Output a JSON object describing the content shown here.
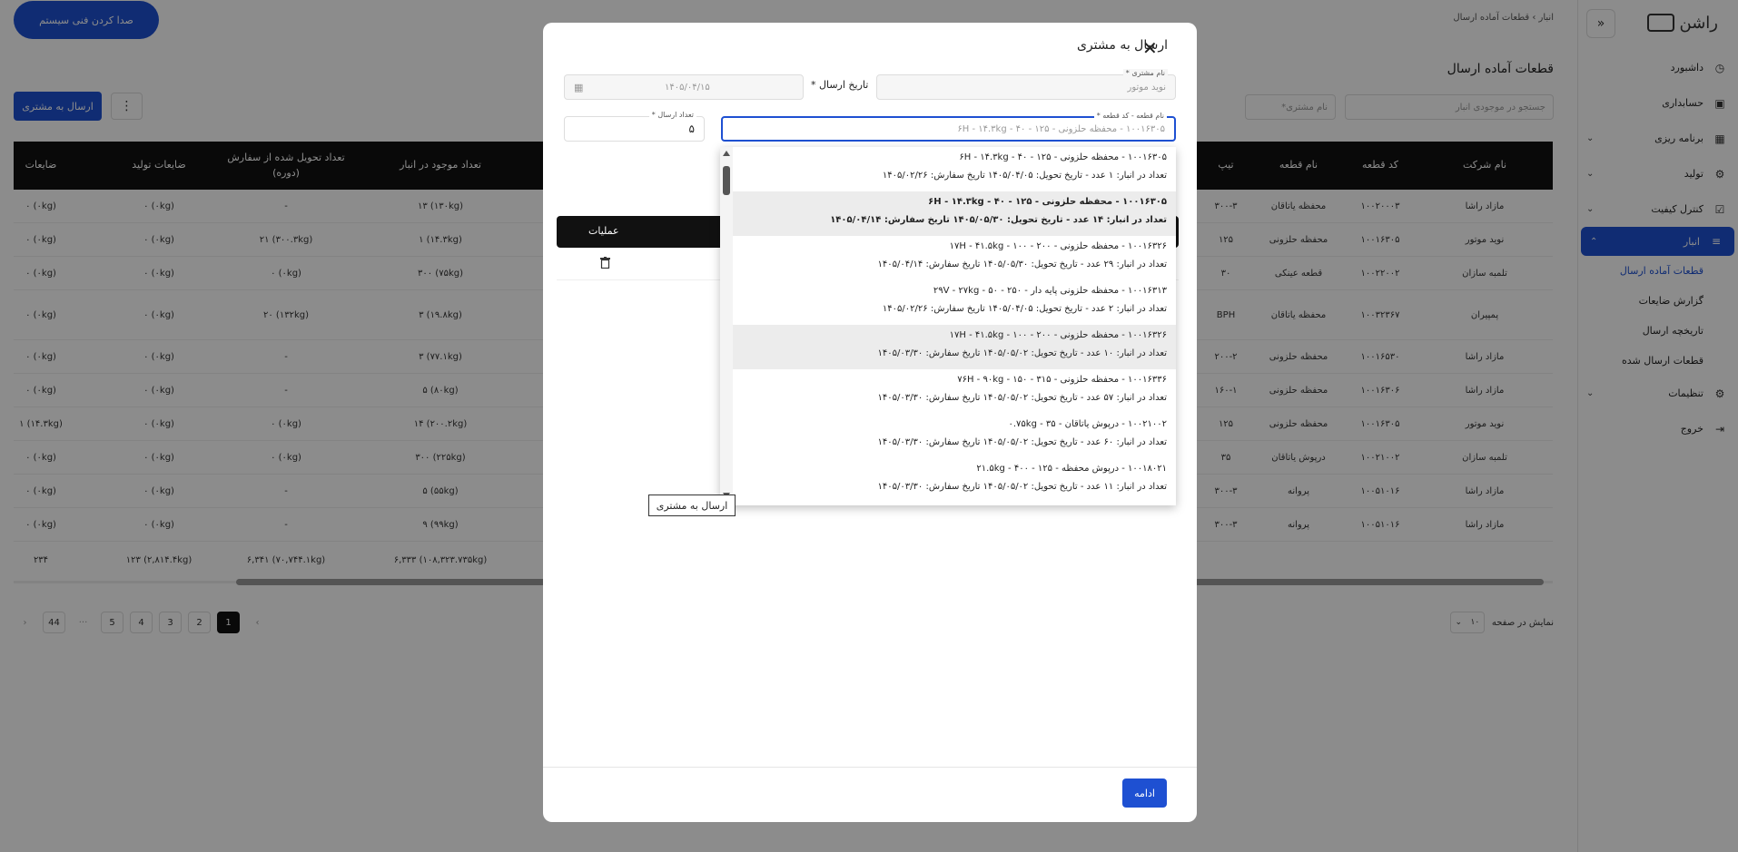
{
  "sidebar": {
    "logo_text": "راشن",
    "items": [
      {
        "label": "داشبورد",
        "icon": "dashboard-icon",
        "chev": ""
      },
      {
        "label": "حسابداری",
        "icon": "calculator-icon",
        "chev": ""
      },
      {
        "label": "برنامه ریزی",
        "icon": "calendar-icon",
        "chev": "⌄"
      },
      {
        "label": "تولید",
        "icon": "factory-icon",
        "chev": "⌄"
      },
      {
        "label": "کنترل کیفیت",
        "icon": "checkbox-icon",
        "chev": "⌄"
      }
    ],
    "active_item": {
      "label": "انبار",
      "icon": "database-icon",
      "chev": "⌃"
    },
    "sub_items": [
      "قطعات آماده ارسال",
      "گزارش ضایعات",
      "تاریخچه ارسال",
      "قطعات ارسال شده"
    ],
    "bottom_items": [
      {
        "label": "تنظیمات",
        "icon": "gear-icon",
        "chev": "⌄"
      },
      {
        "label": "خروج",
        "icon": "logout-icon",
        "chev": ""
      }
    ]
  },
  "breadcrumb": "انبار › قطعات آماده ارسال",
  "page_title": "قطعات آماده ارسال",
  "filters": {
    "search_placeholder": "جستجو در موجودی انبار",
    "customer_placeholder": "نام مشتری*"
  },
  "toolbar": {
    "send_label": "ارسال به مشتری",
    "more_label": "⋮"
  },
  "support_button": "صدا کردن فنی سیستم",
  "table": {
    "headers": [
      "نام شرکت",
      "کد قطعه",
      "نام قطعه",
      "تیپ",
      "تعداد موجود در انبار",
      "تعداد تحویل شده از سفارش (دوره)",
      "ضایعات تولید",
      "ضایعات"
    ],
    "rows": [
      [
        "مازاد راشا",
        "۱۰۰۲۰۰۰۳",
        "محفظه یاتاقان",
        "۳۰۰-۳",
        "(۱۳۰kg) ۱۳",
        "-",
        "(۰kg) ۰",
        "(۰kg) ۰"
      ],
      [
        "نوید موتور",
        "۱۰۰۱۶۳۰۵",
        "محفظه حلزونی",
        "۱۲۵",
        "(۱۴.۳kg) ۱",
        "(۳۰۰.۳kg) ۲۱",
        "(۰kg) ۰",
        "(۰kg) ۰"
      ],
      [
        "تلمبه سازان",
        "۱۰۰۲۲۰۰۲",
        "قطعه عینکی",
        "۳۰",
        "(۷۵kg) ۳۰۰",
        "(۰kg) ۰",
        "(۰kg) ۰",
        "(۰kg) ۰"
      ],
      [
        "پمپیران",
        "۱۰۰۳۲۳۶۷",
        "محفظه یاتاقان",
        "BPH",
        "(۱۹.۸kg) ۳",
        "(۱۳۲kg) ۲۰",
        "(۰kg) ۰",
        "(۰kg) ۰"
      ],
      [
        "مازاد راشا",
        "۱۰۰۱۶۵۳۰",
        "محفظه حلزونی",
        "۲۰۰-۲",
        "(۷۷.۱kg) ۳",
        "-",
        "(۰kg) ۰",
        "(۰kg) ۰"
      ],
      [
        "مازاد راشا",
        "۱۰۰۱۶۳۰۶",
        "محفظه حلزونی",
        "۱۶۰-۱",
        "(۸۰kg) ۵",
        "-",
        "(۰kg) ۰",
        "(۰kg) ۰"
      ],
      [
        "نوید موتور",
        "۱۰۰۱۶۳۰۵",
        "محفظه حلزونی",
        "۱۲۵",
        "(۲۰۰.۲kg) ۱۴",
        "(۰kg) ۰",
        "(۰kg) ۰",
        "(۱۴.۳kg) ۱"
      ],
      [
        "تلمبه سازان",
        "۱۰۰۲۱۰۰۲",
        "درپوش یاتاقان",
        "۳۵",
        "(۲۲۵kg) ۳۰۰",
        "(۰kg) ۰",
        "(۰kg) ۰",
        "(۰kg) ۰"
      ],
      [
        "مازاد راشا",
        "۱۰۰۵۱۰۱۶",
        "پروانه",
        "۳۰۰-۳",
        "(۵۵kg) ۵",
        "-",
        "(۰kg) ۰",
        "(۰kg) ۰"
      ],
      [
        "مازاد راشا",
        "۱۰۰۵۱۰۱۶",
        "پروانه",
        "۳۰۰-۳",
        "(۹۹kg) ۹",
        "-",
        "(۰kg) ۰",
        "(۰kg) ۰"
      ]
    ],
    "totals": [
      "(۱۰۸,۳۲۳.۷۳۵kg) ۶,۳۳۳",
      "(۷۰,۷۴۴.۱kg) ۶,۳۴۱",
      "(۲,۸۱۴.۴kg) ۱۲۳",
      "۲۳۴"
    ]
  },
  "pagination": {
    "pages": [
      "44",
      "···",
      "5",
      "4",
      "3",
      "2",
      "1"
    ],
    "prev": "‹",
    "next": "›",
    "per_page_label": "نمایش در صفحه",
    "per_page_value": "۱۰"
  },
  "modal": {
    "title": "ارسال به مشتری",
    "customer": {
      "label": "نام مشتری *",
      "value": "نوید موتور"
    },
    "date": {
      "label": "تاریخ ارسال *",
      "value": "۱۴۰۵/۰۴/۱۵"
    },
    "part": {
      "label": "نام قطعه - کد قطعه *",
      "value": "۱۰۰۱۶۳۰۵ - محفظه حلزونی - ۱۲۵ - ۴۰ - ۶H - ۱۴.۳kg"
    },
    "qty": {
      "label": "تعداد ارسال *",
      "value": "۵"
    },
    "table_header": "عملیات",
    "continue_label": "ادامه",
    "tooltip": "ارسال به مشتری"
  },
  "dropdown": [
    {
      "l1": "۱۰۰۱۶۳۰۵ - محفظه حلزونی - ۱۲۵ - ۴۰ - ۶H - ۱۴.۳kg",
      "l2": "تعداد در انبار: ۱ عدد  -  تاریخ تحویل: ۱۴۰۵/۰۴/۰۵  تاریخ سفارش: ۱۴۰۵/۰۲/۲۶"
    },
    {
      "l1": "۱۰۰۱۶۳۰۵ - محفظه حلزونی - ۱۲۵ - ۴۰ - ۶H - ۱۴.۳kg",
      "l2": "تعداد در انبار: ۱۴ عدد  -  تاریخ تحویل: ۱۴۰۵/۰۵/۳۰  تاریخ سفارش: ۱۴۰۵/۰۴/۱۴"
    },
    {
      "l1": "۱۰۰۱۶۳۲۶ - محفظه حلزونی - ۲۰۰ - ۱۰۰ - ۱۷H - ۴۱.۵kg",
      "l2": "تعداد در انبار: ۲۹ عدد  -  تاریخ تحویل: ۱۴۰۵/۰۵/۳۰  تاریخ سفارش: ۱۴۰۵/۰۴/۱۴"
    },
    {
      "l1": "۱۰۰۱۶۳۱۳ - محفظه حلزونی پایه دار - ۲۵۰ - ۵۰ - ۲۹V - ۲۷kg",
      "l2": "تعداد در انبار: ۲ عدد  -  تاریخ تحویل: ۱۴۰۵/۰۴/۰۵  تاریخ سفارش: ۱۴۰۵/۰۲/۲۶"
    },
    {
      "l1": "۱۰۰۱۶۳۲۶ - محفظه حلزونی - ۲۰۰ - ۱۰۰ - ۱۷H - ۴۱.۵kg",
      "l2": "تعداد در انبار: ۱۰ عدد  -  تاریخ تحویل: ۱۴۰۵/۰۵/۰۲  تاریخ سفارش: ۱۴۰۵/۰۳/۳۰"
    },
    {
      "l1": "۱۰۰۱۶۳۳۶ - محفظه حلزونی - ۳۱۵ - ۱۵۰ - ۷۶H - ۹۰kg",
      "l2": "تعداد در انبار: ۵۷ عدد  -  تاریخ تحویل: ۱۴۰۵/۰۵/۰۲  تاریخ سفارش: ۱۴۰۵/۰۳/۳۰"
    },
    {
      "l1": "۱۰۰۲۱۰۰۲ - درپوش یاتاقان - ۳۵ - ۰.۷۵kg",
      "l2": "تعداد در انبار: ۶۰ عدد  -  تاریخ تحویل: ۱۴۰۵/۰۵/۰۲  تاریخ سفارش: ۱۴۰۵/۰۳/۳۰"
    },
    {
      "l1": "۱۰۰۱۸۰۲۱ - درپوش محفظه - ۱۲۵ - ۴۰۰ - ۲۱.۵kg",
      "l2": "تعداد در انبار: ۱۱ عدد  -  تاریخ تحویل: ۱۴۰۵/۰۵/۰۲  تاریخ سفارش: ۱۴۰۵/۰۳/۳۰"
    }
  ]
}
